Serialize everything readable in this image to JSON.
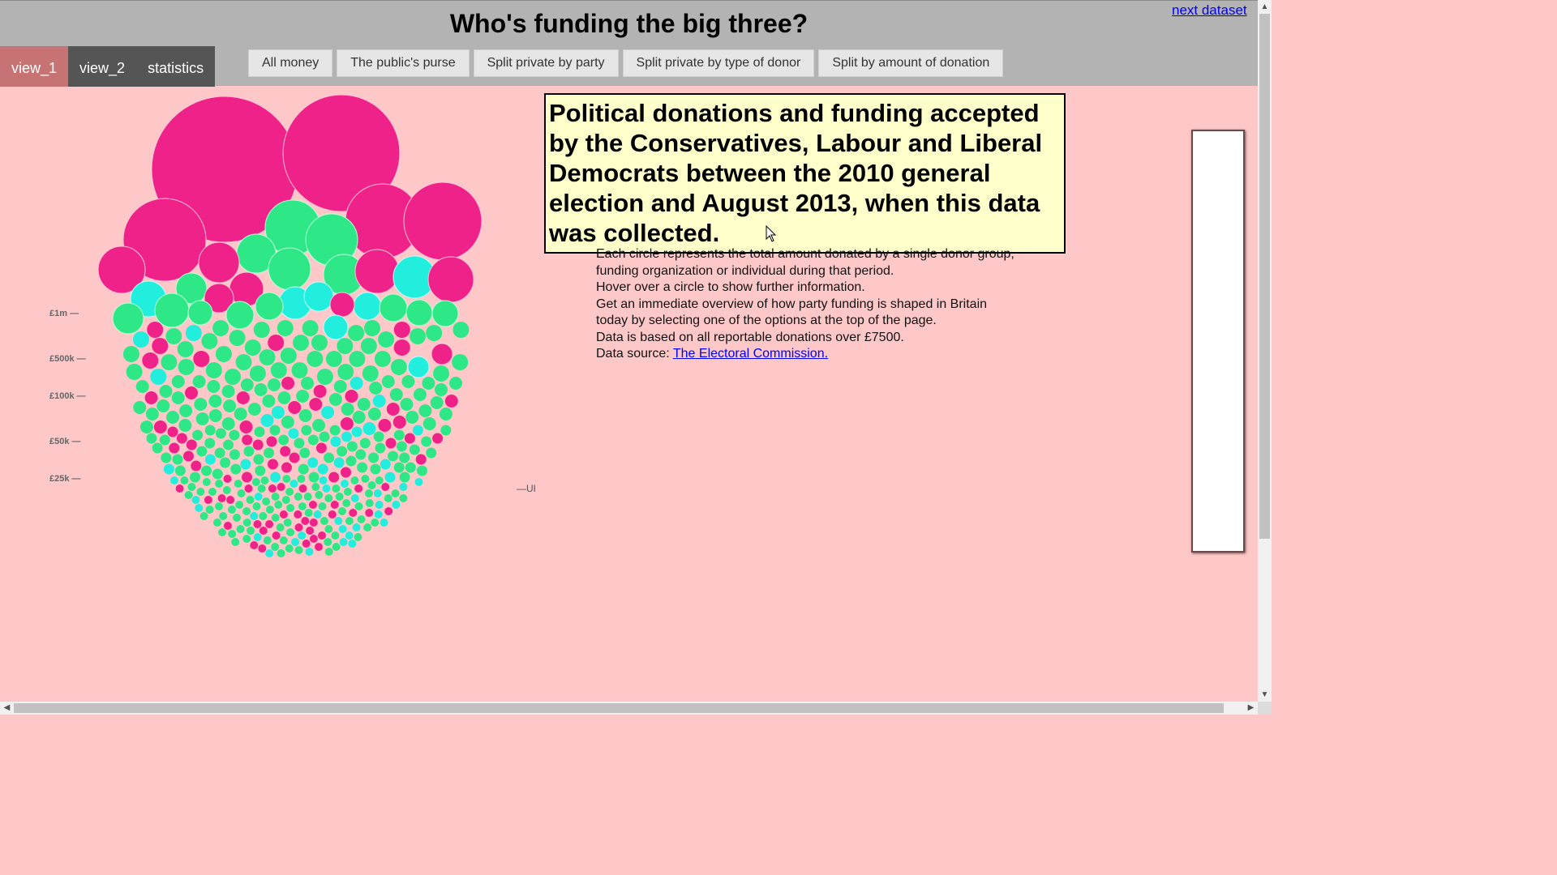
{
  "header": {
    "title": "Who's funding the big three?",
    "next_link": "next dataset",
    "tabs": [
      {
        "label": "view_1",
        "active": true
      },
      {
        "label": "view_2",
        "active": false
      },
      {
        "label": "statistics",
        "active": false
      }
    ],
    "filters": [
      "All money",
      "The public's purse",
      "Split private by party",
      "Split private by type of donor",
      "Split by amount of donation"
    ]
  },
  "tooltip": {
    "text": "Political donations and funding accepted by the Conservatives, Labour and Liberal Democrats between the 2010 general election and August 2013, when this data was collected."
  },
  "description": {
    "lines": [
      "Each circle represents the total amount donated by a single donor group, funding organization or individual during that period.",
      "Hover over a circle to show further information.",
      "Get an immediate overview of how party funding is shaped in Britain today by selecting one of the options at the top of the page.",
      "Data is based on all reportable donations over £7500."
    ],
    "source_prefix": "Data source: ",
    "source_link": "The Electoral Commission."
  },
  "chart_data": {
    "type": "scatter",
    "title": "",
    "scale_labels": [
      "£1m —",
      "£500k —",
      "£100k —",
      "£50k —",
      "£25k —"
    ],
    "reference_label": "—UK average salary",
    "colors": {
      "magenta": "#ee2288",
      "green": "#2ee888",
      "cyan": "#22eedd"
    }
  },
  "colors": {
    "background": "#ffc8c8",
    "header": "#b3b3b3",
    "tab_active": "#c77373",
    "tab_inactive": "#555555",
    "tooltip_bg": "#ffffcc"
  }
}
